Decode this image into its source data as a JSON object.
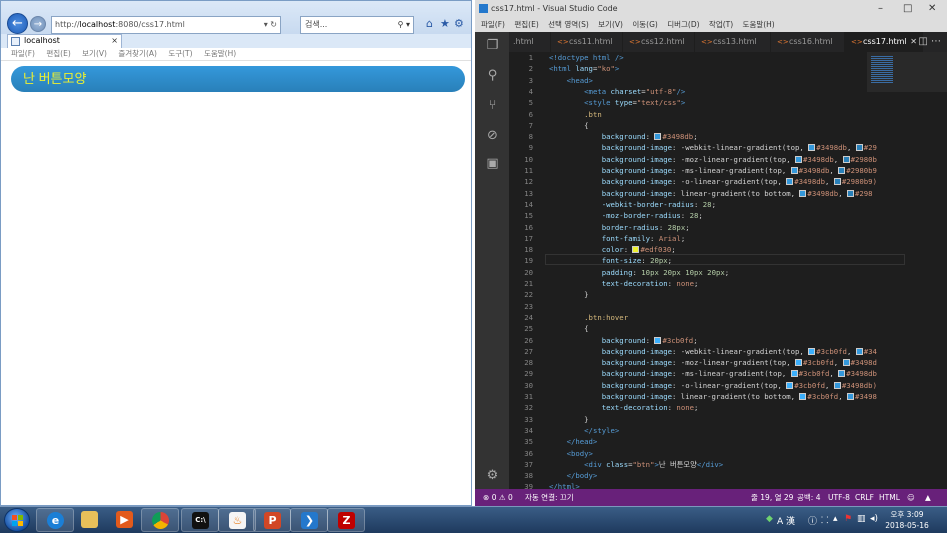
{
  "browser": {
    "url_prefix": "http://",
    "url_host": "localhost",
    "url_rest": ":8080/css17.html",
    "address_icons": "▾ ↻",
    "search_placeholder": "검색...",
    "search_icons": "⚲ ▾",
    "tab_title": "localhost",
    "tab_close": "×",
    "menu": [
      "파일(F)",
      "편집(E)",
      "보기(V)",
      "즐겨찾기(A)",
      "도구(T)",
      "도움말(H)"
    ],
    "page_button_text": "난 버튼모양",
    "colors": {
      "button_bg": "#3498db",
      "button_text": "#edf030"
    }
  },
  "editor": {
    "window_title": "css17.html - Visual Studio Code",
    "menu": [
      "파일(F)",
      "편집(E)",
      "선택 영역(S)",
      "보기(V)",
      "이동(G)",
      "디버그(D)",
      "작업(T)",
      "도움말(H)"
    ],
    "tabs": [
      ".html",
      "css11.html",
      "css12.html",
      "css13.html",
      "css16.html",
      "css17.html"
    ],
    "active_tab": "css17.html",
    "code_lines": [
      [
        [
          "t",
          "<!doctype html />"
        ]
      ],
      [
        [
          "t",
          "<html "
        ],
        [
          "a",
          "lang"
        ],
        [
          "",
          "="
        ],
        [
          "s",
          "\"ko\""
        ],
        [
          "t",
          ">"
        ]
      ],
      [
        [
          "",
          "    "
        ],
        [
          "t",
          "<head>"
        ]
      ],
      [
        [
          "",
          "        "
        ],
        [
          "t",
          "<meta "
        ],
        [
          "a",
          "charset"
        ],
        [
          "",
          "="
        ],
        [
          "s",
          "\"utf-8\""
        ],
        [
          "t",
          "/>"
        ]
      ],
      [
        [
          "",
          "        "
        ],
        [
          "t",
          "<style "
        ],
        [
          "a",
          "type"
        ],
        [
          "",
          "="
        ],
        [
          "s",
          "\"text/css\""
        ],
        [
          "t",
          ">"
        ]
      ],
      [
        [
          "",
          "        "
        ],
        [
          "p",
          ".btn"
        ]
      ],
      [
        [
          "",
          "        {"
        ]
      ],
      [
        [
          "",
          "            "
        ],
        [
          "a",
          "background"
        ],
        [
          "",
          ": "
        ],
        [
          "sw",
          "#3498db"
        ],
        [
          "s",
          "#3498db"
        ],
        [
          "",
          ";"
        ]
      ],
      [
        [
          "",
          "            "
        ],
        [
          "a",
          "background-image"
        ],
        [
          "",
          ": -webkit-linear-gradient(top, "
        ],
        [
          "sw",
          "#3498db"
        ],
        [
          "s",
          "#3498db"
        ],
        [
          "",
          ", "
        ],
        [
          "sw",
          "#2980b9"
        ],
        [
          "s",
          "#29"
        ]
      ],
      [
        [
          "",
          "            "
        ],
        [
          "a",
          "background-image"
        ],
        [
          "",
          ": -moz-linear-gradient(top, "
        ],
        [
          "sw",
          "#3498db"
        ],
        [
          "s",
          "#3498db"
        ],
        [
          "",
          ", "
        ],
        [
          "sw",
          "#2980b9"
        ],
        [
          "s",
          "#2980b"
        ]
      ],
      [
        [
          "",
          "            "
        ],
        [
          "a",
          "background-image"
        ],
        [
          "",
          ": -ms-linear-gradient(top, "
        ],
        [
          "sw",
          "#3498db"
        ],
        [
          "s",
          "#3498db"
        ],
        [
          "",
          ", "
        ],
        [
          "sw",
          "#2980b9"
        ],
        [
          "s",
          "#2980b9"
        ]
      ],
      [
        [
          "",
          "            "
        ],
        [
          "a",
          "background-image"
        ],
        [
          "",
          ": -o-linear-gradient(top, "
        ],
        [
          "sw",
          "#3498db"
        ],
        [
          "s",
          "#3498db"
        ],
        [
          "",
          ", "
        ],
        [
          "sw",
          "#2980b9"
        ],
        [
          "s",
          "#2980b9)"
        ]
      ],
      [
        [
          "",
          "            "
        ],
        [
          "a",
          "background-image"
        ],
        [
          "",
          ": linear-gradient(to bottom, "
        ],
        [
          "sw",
          "#3498db"
        ],
        [
          "s",
          "#3498db"
        ],
        [
          "",
          ", "
        ],
        [
          "sw",
          "#2980b9"
        ],
        [
          "s",
          "#298"
        ]
      ],
      [
        [
          "",
          "            "
        ],
        [
          "a",
          "-webkit-border-radius"
        ],
        [
          "",
          ": "
        ],
        [
          "n",
          "28"
        ],
        [
          "",
          ";"
        ]
      ],
      [
        [
          "",
          "            "
        ],
        [
          "a",
          "-moz-border-radius"
        ],
        [
          "",
          ": "
        ],
        [
          "n",
          "28"
        ],
        [
          "",
          ";"
        ]
      ],
      [
        [
          "",
          "            "
        ],
        [
          "a",
          "border-radius"
        ],
        [
          "",
          ": "
        ],
        [
          "n",
          "28px"
        ],
        [
          "",
          ";"
        ]
      ],
      [
        [
          "",
          "            "
        ],
        [
          "a",
          "font-family"
        ],
        [
          "",
          ": "
        ],
        [
          "s",
          "Arial"
        ],
        [
          "",
          ";"
        ]
      ],
      [
        [
          "",
          "            "
        ],
        [
          "a",
          "color"
        ],
        [
          "",
          ": "
        ],
        [
          "sw",
          "#edf030"
        ],
        [
          "s",
          "#edf030"
        ],
        [
          "",
          ";"
        ]
      ],
      [
        [
          "",
          "            "
        ],
        [
          "a",
          "font-size"
        ],
        [
          "",
          ": "
        ],
        [
          "n",
          "20px"
        ],
        [
          "",
          ";"
        ]
      ],
      [
        [
          "",
          "            "
        ],
        [
          "a",
          "padding"
        ],
        [
          "",
          ": "
        ],
        [
          "n",
          "10px 20px 10px 20px"
        ],
        [
          "",
          ";"
        ]
      ],
      [
        [
          "",
          "            "
        ],
        [
          "a",
          "text-decoration"
        ],
        [
          "",
          ": "
        ],
        [
          "s",
          "none"
        ],
        [
          "",
          ";"
        ]
      ],
      [
        [
          "",
          "        }"
        ]
      ],
      [
        [
          "",
          ""
        ]
      ],
      [
        [
          "",
          "        "
        ],
        [
          "p",
          ".btn:hover"
        ]
      ],
      [
        [
          "",
          "        {"
        ]
      ],
      [
        [
          "",
          "            "
        ],
        [
          "a",
          "background"
        ],
        [
          "",
          ": "
        ],
        [
          "sw",
          "#3cb0fd"
        ],
        [
          "s",
          "#3cb0fd"
        ],
        [
          "",
          ";"
        ]
      ],
      [
        [
          "",
          "            "
        ],
        [
          "a",
          "background-image"
        ],
        [
          "",
          ": -webkit-linear-gradient(top, "
        ],
        [
          "sw",
          "#3cb0fd"
        ],
        [
          "s",
          "#3cb0fd"
        ],
        [
          "",
          ", "
        ],
        [
          "sw",
          "#3498db"
        ],
        [
          "s",
          "#34"
        ]
      ],
      [
        [
          "",
          "            "
        ],
        [
          "a",
          "background-image"
        ],
        [
          "",
          ": -moz-linear-gradient(top, "
        ],
        [
          "sw",
          "#3cb0fd"
        ],
        [
          "s",
          "#3cb0fd"
        ],
        [
          "",
          ", "
        ],
        [
          "sw",
          "#3498db"
        ],
        [
          "s",
          "#3498d"
        ]
      ],
      [
        [
          "",
          "            "
        ],
        [
          "a",
          "background-image"
        ],
        [
          "",
          ": -ms-linear-gradient(top, "
        ],
        [
          "sw",
          "#3cb0fd"
        ],
        [
          "s",
          "#3cb0fd"
        ],
        [
          "",
          ", "
        ],
        [
          "sw",
          "#3498db"
        ],
        [
          "s",
          "#3498db"
        ]
      ],
      [
        [
          "",
          "            "
        ],
        [
          "a",
          "background-image"
        ],
        [
          "",
          ": -o-linear-gradient(top, "
        ],
        [
          "sw",
          "#3cb0fd"
        ],
        [
          "s",
          "#3cb0fd"
        ],
        [
          "",
          ", "
        ],
        [
          "sw",
          "#3498db"
        ],
        [
          "s",
          "#3498db)"
        ]
      ],
      [
        [
          "",
          "            "
        ],
        [
          "a",
          "background-image"
        ],
        [
          "",
          ": linear-gradient(to bottom, "
        ],
        [
          "sw",
          "#3cb0fd"
        ],
        [
          "s",
          "#3cb0fd"
        ],
        [
          "",
          ", "
        ],
        [
          "sw",
          "#3498db"
        ],
        [
          "s",
          "#3498"
        ]
      ],
      [
        [
          "",
          "            "
        ],
        [
          "a",
          "text-decoration"
        ],
        [
          "",
          ": "
        ],
        [
          "s",
          "none"
        ],
        [
          "",
          ";"
        ]
      ],
      [
        [
          "",
          "        }"
        ]
      ],
      [
        [
          "",
          "        "
        ],
        [
          "t",
          "</style>"
        ]
      ],
      [
        [
          "",
          "    "
        ],
        [
          "t",
          "</head>"
        ]
      ],
      [
        [
          "",
          "    "
        ],
        [
          "t",
          "<body>"
        ]
      ],
      [
        [
          "",
          "        "
        ],
        [
          "t",
          "<div "
        ],
        [
          "a",
          "class"
        ],
        [
          "",
          "="
        ],
        [
          "s",
          "\"btn\""
        ],
        [
          "t",
          ">"
        ],
        [
          "",
          "난 버튼모양"
        ],
        [
          "t",
          "</div>"
        ]
      ],
      [
        [
          "",
          "    "
        ],
        [
          "t",
          "</body>"
        ]
      ],
      [
        [
          "t",
          "</html>"
        ]
      ]
    ],
    "status": {
      "errors": "0",
      "warnings": "0",
      "autoconnect": "자동 연결: 끄기",
      "cursor": "줄 19, 열 29",
      "spaces": "공백: 4",
      "encoding": "UTF-8",
      "eol": "CRLF",
      "language": "HTML"
    }
  },
  "taskbar": {
    "apps": [
      "internet-explorer",
      "file-explorer",
      "media-player",
      "chrome",
      "command-prompt",
      "java",
      "ms-powerpoint",
      "vs-code",
      "filezilla"
    ],
    "tray_lang": "A 漢",
    "clock_time": "오후 3:09",
    "clock_date": "2018-05-16"
  }
}
